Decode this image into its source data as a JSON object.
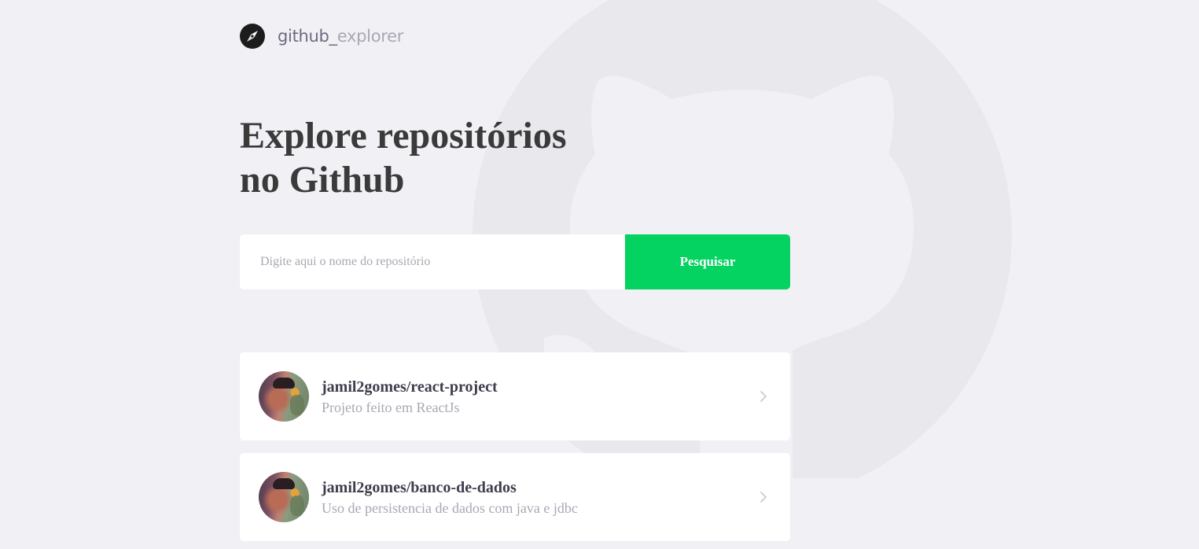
{
  "header": {
    "logo_icon": "compass-icon",
    "logo_text_primary": "github_",
    "logo_text_secondary": "explorer"
  },
  "hero": {
    "title_line1": "Explore repositórios",
    "title_line2": "no Github"
  },
  "search": {
    "placeholder": "Digite aqui o nome do repositório",
    "value": "",
    "button_label": "Pesquisar"
  },
  "repositories": [
    {
      "name": "jamil2gomes/react-project",
      "description": "Projeto feito em ReactJs",
      "avatar_icon": "avatar-photo",
      "chevron_icon": "chevron-right-icon"
    },
    {
      "name": "jamil2gomes/banco-de-dados",
      "description": "Uso de persistencia de dados com java e jdbc",
      "avatar_icon": "avatar-photo",
      "chevron_icon": "chevron-right-icon"
    }
  ],
  "colors": {
    "background": "#f0f0f5",
    "accent_green": "#04d361",
    "text_dark": "#3a3a3a",
    "text_muted": "#a8a8b3"
  }
}
